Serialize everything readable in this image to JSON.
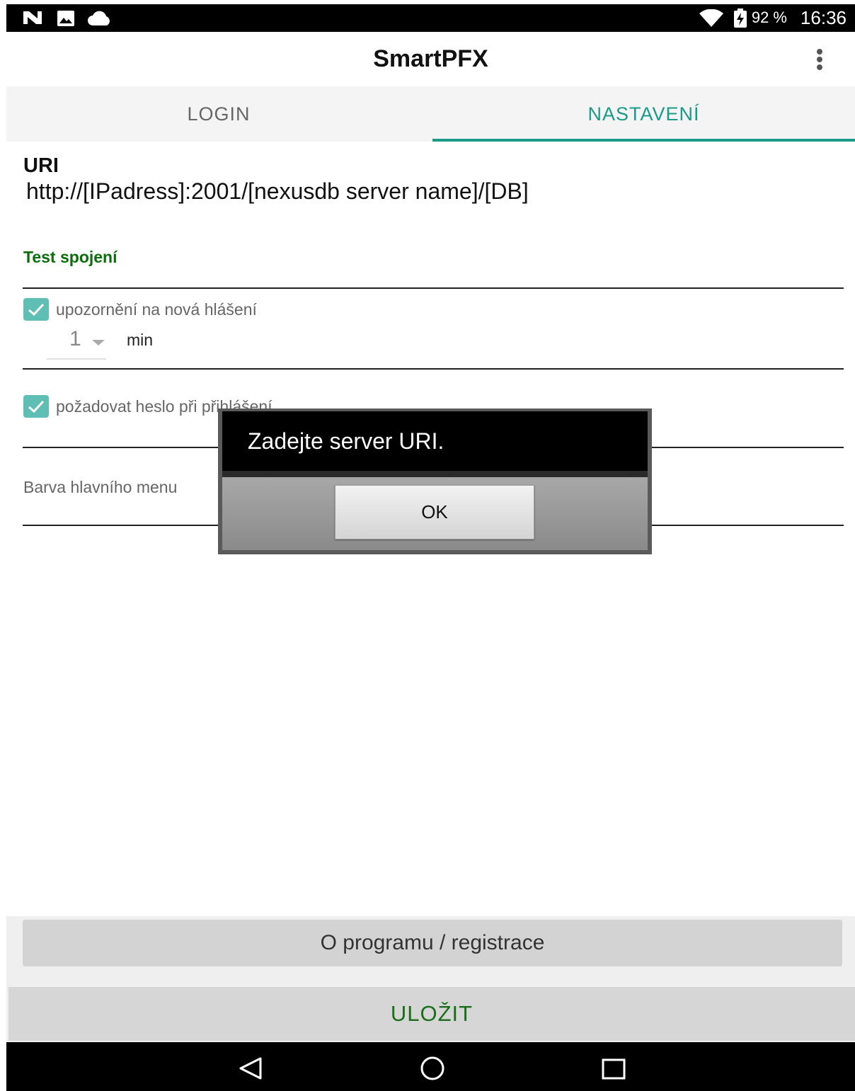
{
  "status_bar": {
    "notification_icons": [
      "n-logo-icon",
      "image-icon",
      "cloud-icon"
    ],
    "system_icons": [
      "wifi-icon",
      "battery-charging-icon"
    ],
    "battery_text": "92 %",
    "clock": "16:36"
  },
  "app_bar": {
    "title": "SmartPFX",
    "menu_icon": "more-vert-icon"
  },
  "tabs": [
    {
      "label": "LOGIN",
      "active": false
    },
    {
      "label": "NASTAVENÍ",
      "active": true
    }
  ],
  "colors": {
    "accent": "#1a9b8a",
    "checkbox": "#5fbfb4",
    "link_green": "#0b6e0b",
    "save_green": "#1a6e1a"
  },
  "settings": {
    "uri_label": "URI",
    "uri_value": "http://[IPadress]:2001/[nexusdb server name]/[DB]",
    "test_connection": "Test spojení",
    "notify": {
      "checked": true,
      "label": "upozornění na nová hlášení",
      "interval_value": "1",
      "interval_unit": "min"
    },
    "require_password": {
      "checked": true,
      "label": "požadovat heslo při přihlášení"
    },
    "menu_color_label": "Barva hlavního menu"
  },
  "dialog": {
    "message": "Zadejte server URI.",
    "ok_label": "OK"
  },
  "bottom": {
    "about_label": "O programu / registrace",
    "save_label": "ULOŽIT"
  },
  "nav_bar": {
    "icons": [
      "back-icon",
      "home-icon",
      "recents-icon"
    ]
  }
}
